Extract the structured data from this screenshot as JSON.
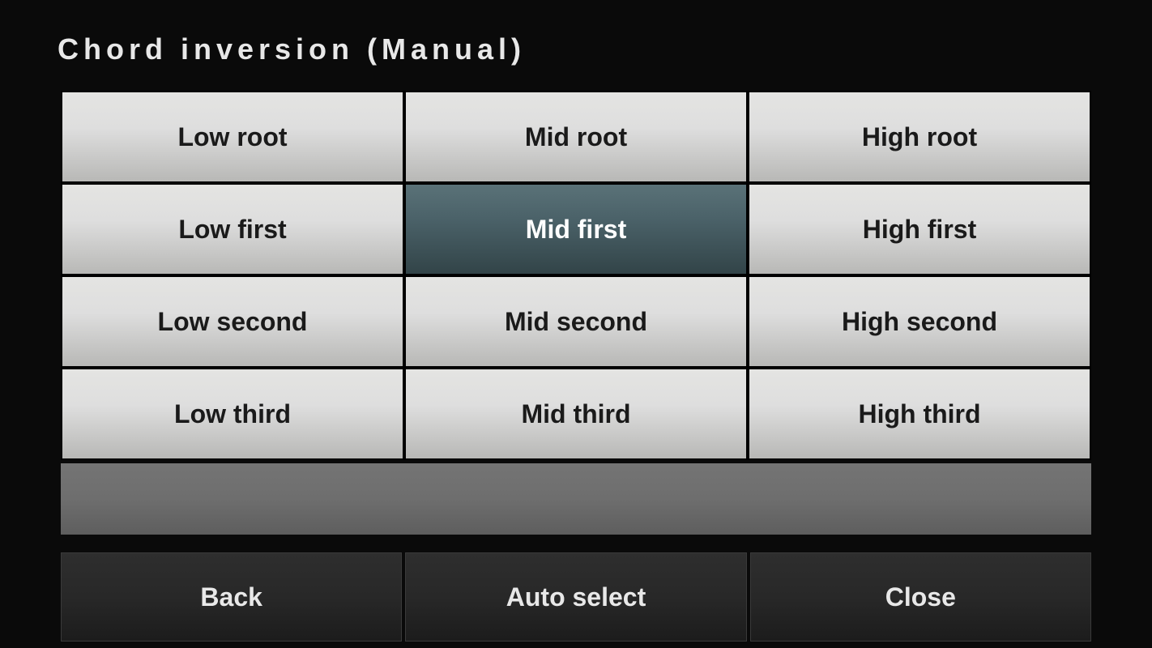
{
  "title": "Chord inversion (Manual)",
  "grid": {
    "cells": [
      {
        "label": "Low root",
        "selected": false
      },
      {
        "label": "Mid root",
        "selected": false
      },
      {
        "label": "High root",
        "selected": false
      },
      {
        "label": "Low first",
        "selected": false
      },
      {
        "label": "Mid first",
        "selected": true
      },
      {
        "label": "High first",
        "selected": false
      },
      {
        "label": "Low second",
        "selected": false
      },
      {
        "label": "Mid second",
        "selected": false
      },
      {
        "label": "High second",
        "selected": false
      },
      {
        "label": "Low third",
        "selected": false
      },
      {
        "label": "Mid third",
        "selected": false
      },
      {
        "label": "High third",
        "selected": false
      }
    ]
  },
  "footer": {
    "back": "Back",
    "auto_select": "Auto select",
    "close": "Close"
  }
}
